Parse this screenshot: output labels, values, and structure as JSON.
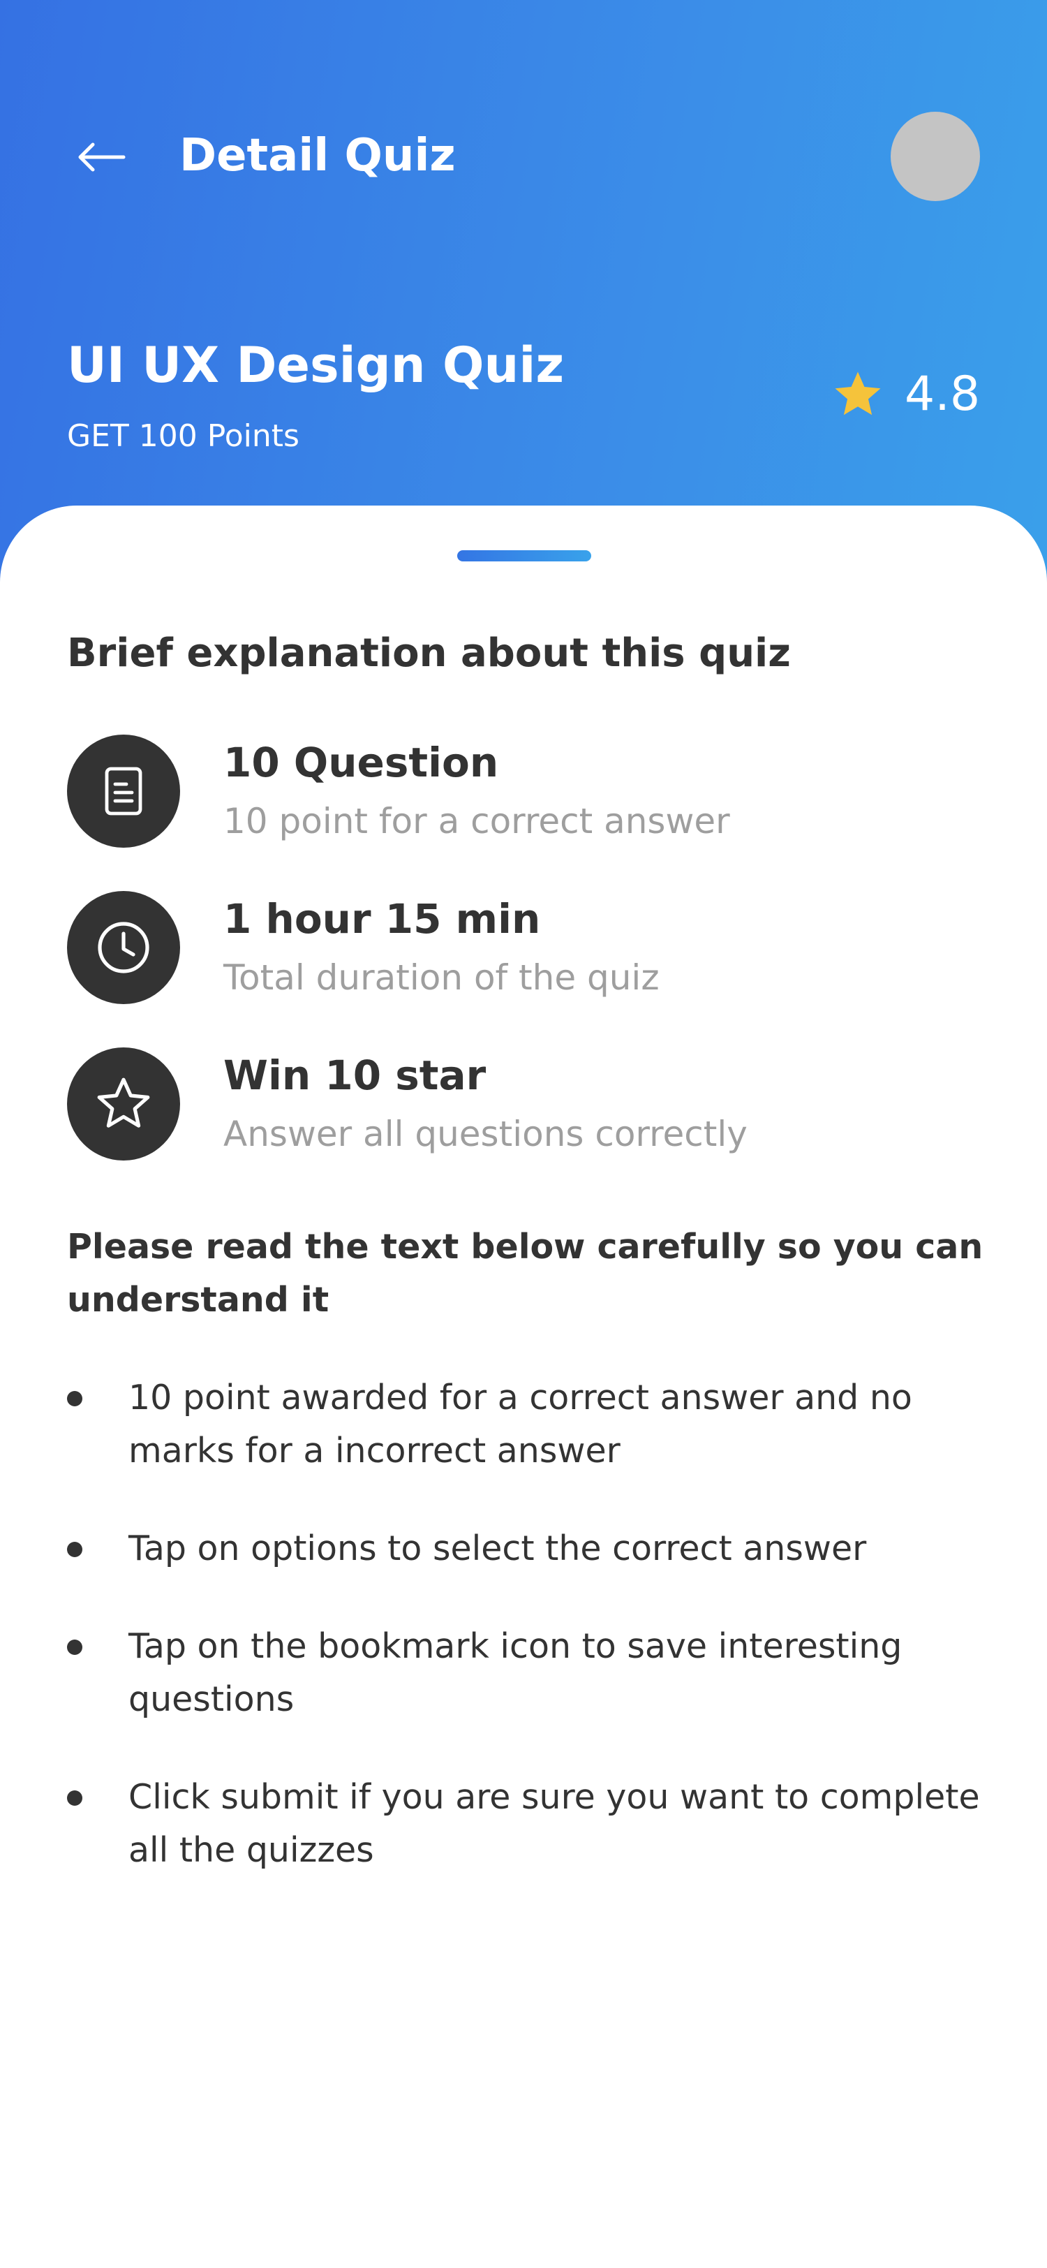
{
  "header": {
    "title": "Detail Quiz",
    "background_colors": [
      "#3571e3",
      "#3aa0ea"
    ],
    "back_icon": "arrow-left-icon"
  },
  "quiz": {
    "title": "UI UX Design Quiz",
    "points": "GET 100 Points",
    "rating": "4.8",
    "rating_icon": "star-icon",
    "star_color": "#f5c33b"
  },
  "details": {
    "heading": "Brief explanation about this quiz",
    "items": [
      {
        "icon": "document-icon",
        "title": "10 Question",
        "subtitle": "10 point for a correct answer"
      },
      {
        "icon": "clock-icon",
        "title": "1 hour 15 min",
        "subtitle": "Total duration of the quiz"
      },
      {
        "icon": "star-outline-icon",
        "title": "Win 10 star",
        "subtitle": "Answer all questions correctly"
      }
    ]
  },
  "instructions": {
    "heading": "Please read the text below carefully so you can understand it",
    "rules": [
      "10 point awarded for a correct answer and no marks for a incorrect answer",
      "Tap on options to select the correct answer",
      "Tap on the bookmark icon to save interesting questions",
      "Click submit if you are sure you want to complete all the quizzes"
    ]
  }
}
